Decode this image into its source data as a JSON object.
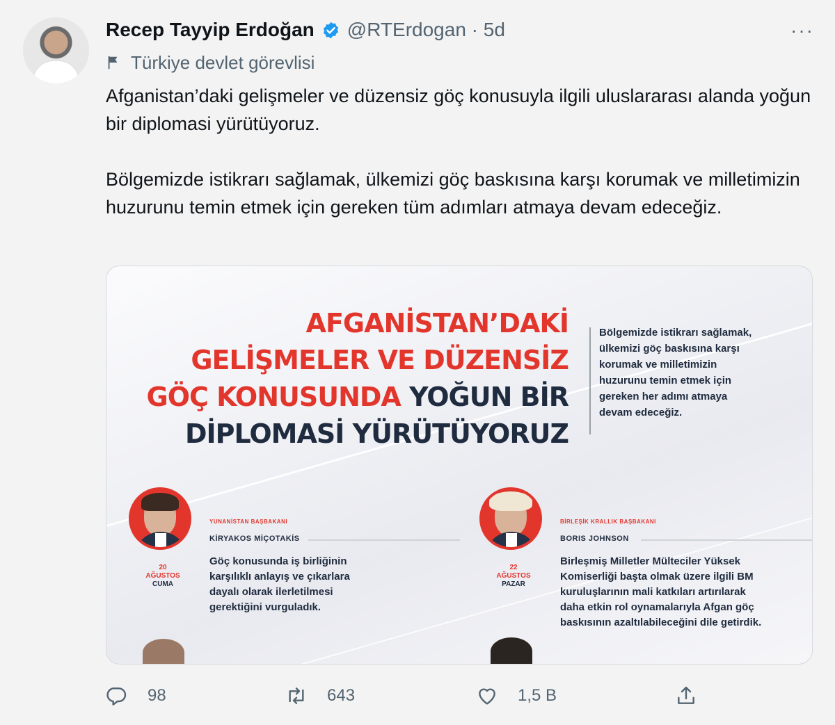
{
  "tweet": {
    "author_name": "Recep Tayyip Erdoğan",
    "handle_time": "@RTErdogan · 5d",
    "label": "Türkiye devlet görevlisi",
    "text_p1": "Afganistan’daki gelişmeler ve düzensiz göç konusuyla ilgili uluslararası alanda yoğun bir diplomasi yürütüyoruz.",
    "text_p2": "Bölgemizde istikrarı sağlamak, ülkemizi göç baskısına karşı korumak ve milletimizin huzurunu temin etmek için gereken tüm adımları atmaya devam edeceğiz.",
    "more": "···"
  },
  "media": {
    "headline": {
      "l1": "AFGANİSTAN’DAKİ",
      "l2": "GELİŞMELER VE DÜZENSİZ",
      "l3_red": "GÖÇ KONUSUNDA ",
      "l3_navy": "YOĞUN BİR",
      "l4": "DİPLOMASİ YÜRÜTÜYORUZ"
    },
    "side_quote": "Bölgemizde istikrarı sağlamak, ülkemizi göç baskısına karşı korumak ve milletimizin huzurunu temin etmek için gereken her adımı atmaya devam edeceğiz.",
    "cards": [
      {
        "role": "YUNANİSTAN BAŞBAKANI",
        "name": "KİRYAKOS MİÇOTAKİS",
        "date_day": "20",
        "date_month": "AĞUSTOS",
        "date_weekday": "CUMA",
        "text": "Göç konusunda iş birliğinin karşılıklı anlayış ve çıkarlara dayalı olarak ilerletilmesi gerektiğini vurguladık."
      },
      {
        "role": "BİRLEŞİK KRALLIK BAŞBAKANI",
        "name": "BORIS JOHNSON",
        "date_day": "22",
        "date_month": "AĞUSTOS",
        "date_weekday": "PAZAR",
        "text": "Birleşmiş Milletler Mülteciler Yüksek Komiserliği başta olmak üzere ilgili BM kuruluşlarının mali katkıları artırılarak daha etkin rol oynamalarıyla Afgan göç baskısının azaltılabileceğini dile getirdik."
      }
    ]
  },
  "actions": {
    "replies": "98",
    "retweets": "643",
    "likes": "1,5 B"
  },
  "colors": {
    "accent_red": "#e2362d",
    "navy": "#1f2b3e",
    "verified_blue": "#1d9bf0",
    "muted_text": "#536471"
  },
  "icons": [
    "verified-badge-icon",
    "flag-icon",
    "more-icon",
    "reply-icon",
    "retweet-icon",
    "like-icon",
    "share-icon"
  ]
}
